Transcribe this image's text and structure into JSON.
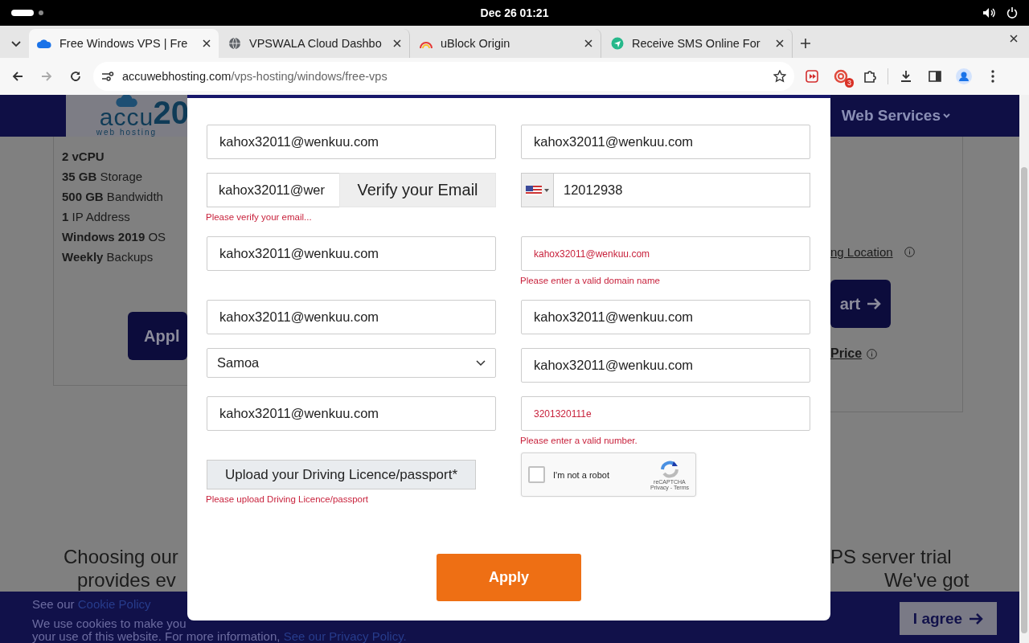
{
  "system_bar": {
    "clock": "Dec 26  01:21"
  },
  "tabs": [
    {
      "title": "Free Windows VPS | Fre",
      "selected": true
    },
    {
      "title": "VPSWALA Cloud Dashbo",
      "selected": false
    },
    {
      "title": "uBlock Origin",
      "selected": false
    },
    {
      "title": "Receive SMS Online For",
      "selected": false
    }
  ],
  "address_bar": {
    "host": "accuwebhosting.com",
    "path": "/vps-hosting/windows/free-vps"
  },
  "extensions": {
    "badge": "3"
  },
  "site": {
    "logo_text": "accu",
    "logo_subtext": "web hosting",
    "logo_number": "20",
    "nav_item": "Web Services",
    "features": [
      "**2 vCPU**",
      "**35 GB** Storage",
      "**500 GB** Bandwidth",
      "**1** IP Address",
      "**Windows 2019** OS",
      "**Weekly** Backups"
    ],
    "apply_button": "Appl",
    "location_link": "ng Location",
    "cart_button": "art",
    "price_link": "Price",
    "intro_left": [
      "Choosing our",
      "provides ev"
    ],
    "intro_right": [
      "PS server trial",
      "We've got"
    ]
  },
  "cookie_bar": {
    "lead": "See our",
    "policy_link": "Cookie Policy",
    "line_1": "We use cookies to make you",
    "line_2": "your use of this website. For more information,",
    "privacy_link": "See our Privacy Policy.",
    "agree_button": "I agree"
  },
  "form": {
    "rows": [
      [
        {
          "kind": "text",
          "value": "kahox32011@wenkuu.com"
        },
        {
          "kind": "text",
          "value": "kahox32011@wenkuu.com"
        }
      ],
      [
        {
          "kind": "verify",
          "value": "kahox32011@wer",
          "button": "Verify your Email",
          "error": "Please verify your email..."
        },
        {
          "kind": "phone",
          "value": "12012938"
        }
      ],
      [
        {
          "kind": "text",
          "value": "kahox32011@wenkuu.com"
        },
        {
          "kind": "invalid_text",
          "value": "kahox32011@wenkuu.com",
          "error": "Please enter a valid domain name"
        }
      ],
      [
        {
          "kind": "text",
          "value": "kahox32011@wenkuu.com"
        },
        {
          "kind": "text",
          "value": "kahox32011@wenkuu.com"
        }
      ],
      [
        {
          "kind": "select",
          "value": "Samoa"
        },
        {
          "kind": "text",
          "value": "kahox32011@wenkuu.com"
        }
      ],
      [
        {
          "kind": "text",
          "value": "kahox32011@wenkuu.com"
        },
        {
          "kind": "invalid_text",
          "value": "3201320111e",
          "error": "Please enter a valid number."
        }
      ],
      [
        {
          "kind": "upload",
          "value": "Upload your Driving Licence/passport*",
          "error": "Please upload Driving Licence/passport"
        },
        {
          "kind": "captcha",
          "value": "I'm not a robot",
          "checked": false,
          "brand": "reCAPTCHA",
          "links": "Privacy - Terms"
        }
      ]
    ],
    "submit": "Apply"
  }
}
